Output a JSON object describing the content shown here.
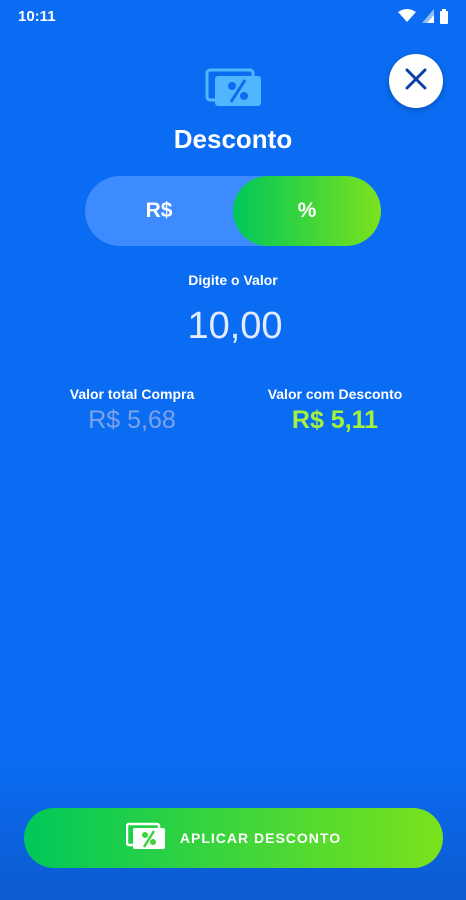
{
  "status_bar": {
    "time": "10:11"
  },
  "header": {
    "title": "Desconto"
  },
  "toggle": {
    "options": [
      {
        "label": "R$",
        "selected": false
      },
      {
        "label": "%",
        "selected": true
      }
    ]
  },
  "input": {
    "label": "Digite o Valor",
    "value": "10,00"
  },
  "summary": {
    "total_label": "Valor total Compra",
    "total_value": "R$ 5,68",
    "discount_label": "Valor com Desconto",
    "discount_value": "R$ 5,11"
  },
  "apply_button": {
    "label": "APLICAR DESCONTO"
  },
  "colors": {
    "background": "#0a6cf2",
    "accent_green": "#7be21c",
    "discount_value": "#a4f23c"
  },
  "icons": [
    "wifi-icon",
    "signal-icon",
    "battery-icon",
    "discount-icon",
    "close-icon"
  ]
}
